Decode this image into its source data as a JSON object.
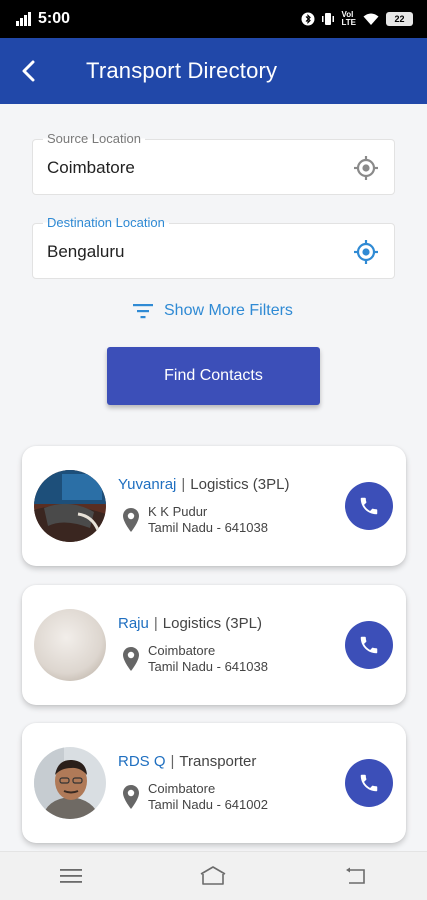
{
  "status": {
    "time": "5:00",
    "vol": "Vol",
    "lte": "LTE",
    "battery": "22"
  },
  "header": {
    "title": "Transport Directory",
    "back_icon": "back-arrow-icon"
  },
  "source": {
    "label": "Source Location",
    "value": "Coimbatore",
    "icon": "location-target-icon",
    "icon_color": "#8a8a8a"
  },
  "destination": {
    "label": "Destination Location",
    "value": "Bengaluru",
    "icon": "location-target-icon",
    "icon_color": "#2f8ad4"
  },
  "filters": {
    "label": "Show More Filters",
    "icon": "filter-icon"
  },
  "find_button": {
    "label": "Find Contacts"
  },
  "contacts": [
    {
      "name": "Yuvanraj",
      "role": "Logistics (3PL)",
      "address_line1": "K K Pudur",
      "address_line2": "Tamil Nadu - 641038"
    },
    {
      "name": "Raju",
      "role": "Logistics (3PL)",
      "address_line1": "Coimbatore",
      "address_line2": "Tamil Nadu - 641038"
    },
    {
      "name": "RDS Q",
      "role": "Transporter",
      "address_line1": "Coimbatore",
      "address_line2": "Tamil Nadu - 641002"
    }
  ],
  "colors": {
    "app_bar": "#2148a9",
    "accent": "#3c4fb8",
    "link": "#2f8ad4",
    "name": "#1f6fc0"
  }
}
